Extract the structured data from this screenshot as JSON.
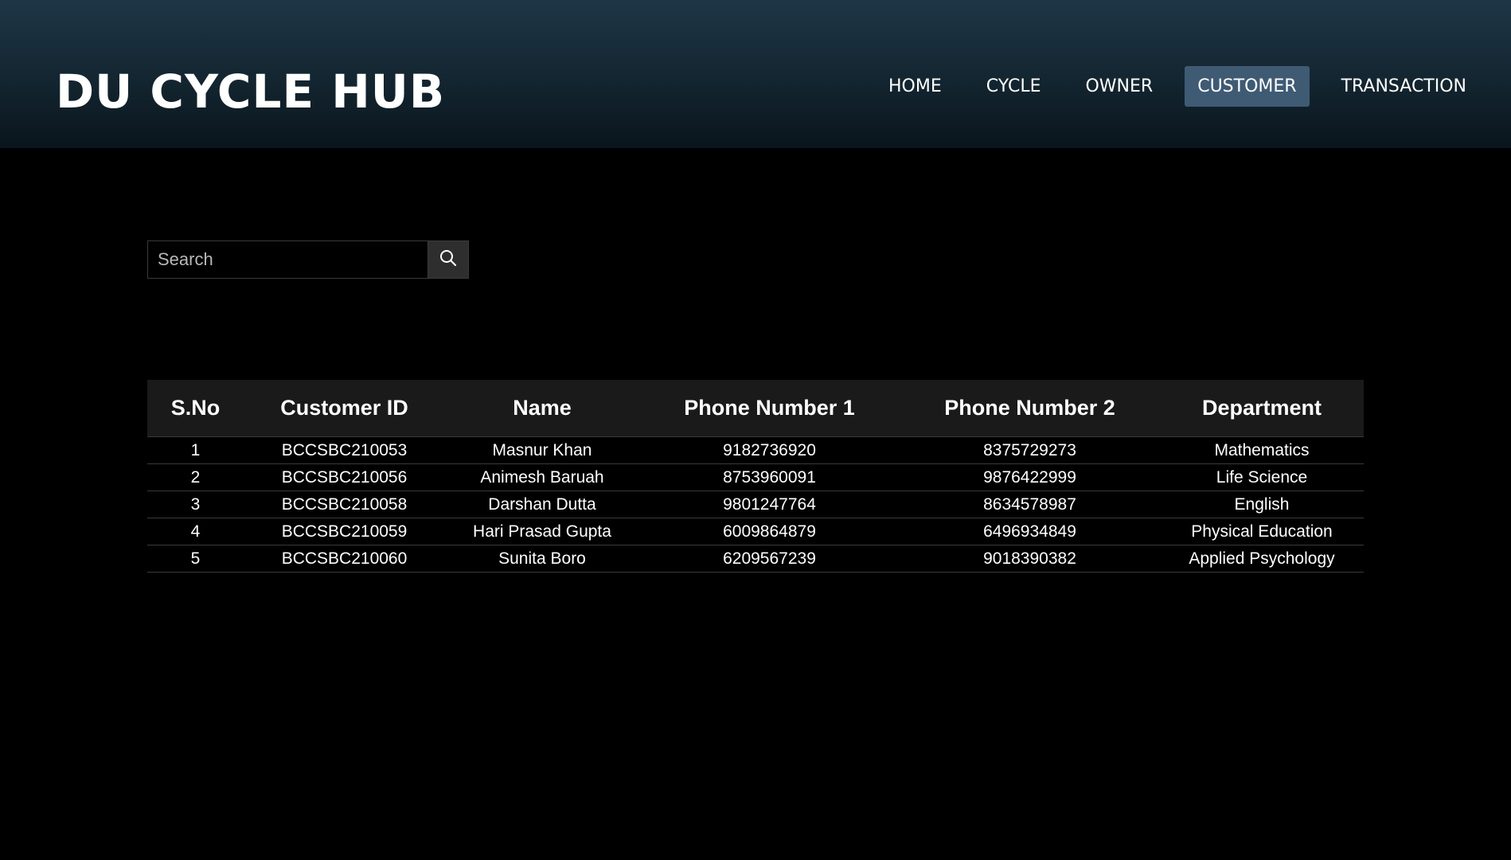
{
  "header": {
    "brand": "DU CYCLE HUB",
    "nav": [
      {
        "label": "HOME",
        "active": false
      },
      {
        "label": "CYCLE",
        "active": false
      },
      {
        "label": "OWNER",
        "active": false
      },
      {
        "label": "CUSTOMER",
        "active": true
      },
      {
        "label": "TRANSACTION",
        "active": false
      }
    ],
    "active_color": "#3f5b74"
  },
  "search": {
    "placeholder": "Search",
    "value": "",
    "icon": "search-icon"
  },
  "table": {
    "columns": [
      "S.No",
      "Customer ID",
      "Name",
      "Phone Number 1",
      "Phone Number 2",
      "Department"
    ],
    "rows": [
      [
        "1",
        "BCCSBC210053",
        "Masnur Khan",
        "9182736920",
        "8375729273",
        "Mathematics"
      ],
      [
        "2",
        "BCCSBC210056",
        "Animesh Baruah",
        "8753960091",
        "9876422999",
        "Life Science"
      ],
      [
        "3",
        "BCCSBC210058",
        "Darshan Dutta",
        "9801247764",
        "8634578987",
        "English"
      ],
      [
        "4",
        "BCCSBC210059",
        "Hari Prasad Gupta",
        "6009864879",
        "6496934849",
        "Physical Education"
      ],
      [
        "5",
        "BCCSBC210060",
        "Sunita Boro",
        "6209567239",
        "9018390382",
        "Applied Psychology"
      ]
    ]
  }
}
